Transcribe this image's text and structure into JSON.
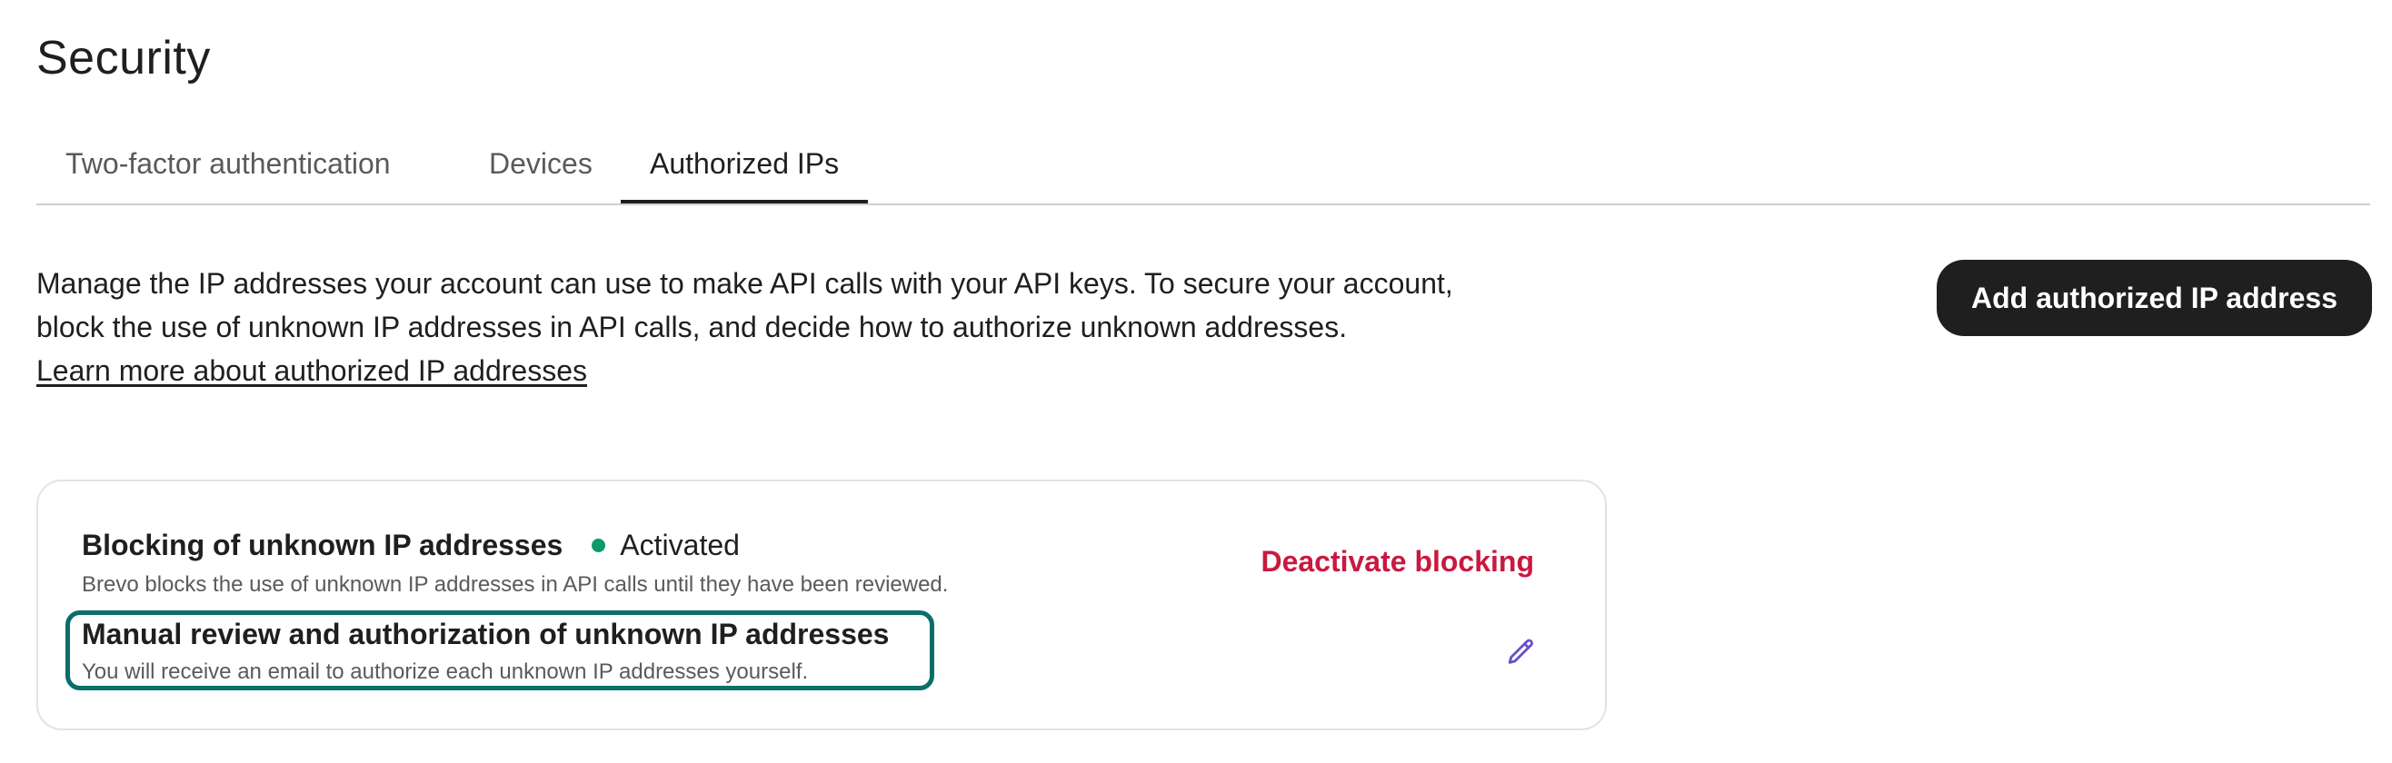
{
  "page": {
    "title": "Security"
  },
  "tabs": [
    {
      "label": "Two-factor authentication",
      "active": false
    },
    {
      "label": "Devices",
      "active": false
    },
    {
      "label": "Authorized IPs",
      "active": true
    }
  ],
  "intro": {
    "line1": "Manage the IP addresses your account can use to make API calls with your API keys. To secure your account,",
    "line2": "block the use of unknown IP addresses in API calls, and decide how to authorize unknown addresses.",
    "learn_more_label": "Learn more about authorized IP addresses"
  },
  "actions": {
    "add_button_label": "Add authorized IP address"
  },
  "blocking_card": {
    "title": "Blocking of unknown IP addresses",
    "status": "Activated",
    "status_color": "#0b9a6d",
    "description": "Brevo blocks the use of unknown IP addresses in API calls until they have been reviewed.",
    "deactivate_label": "Deactivate blocking",
    "deactivate_color": "#c9193f",
    "review_title": "Manual review and authorization of unknown IP addresses",
    "review_description": "You will receive an email to authorize each unknown IP addresses yourself.",
    "edit_icon": "pencil-icon",
    "edit_icon_color": "#6a4fc9",
    "highlight_color": "#0a6e6a"
  }
}
